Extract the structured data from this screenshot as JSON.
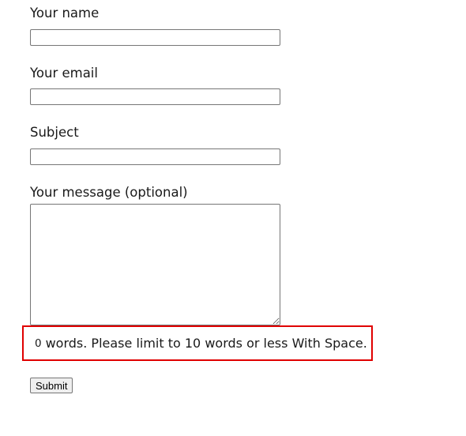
{
  "form": {
    "name": {
      "label": "Your name",
      "value": ""
    },
    "email": {
      "label": "Your email",
      "value": ""
    },
    "subject": {
      "label": "Subject",
      "value": ""
    },
    "message": {
      "label": "Your message (optional)",
      "value": ""
    },
    "word_limit": {
      "count": "0",
      "text": "words. Please limit to 10 words or less With Space.",
      "highlight_color": "#e00000"
    },
    "submit_label": "Submit"
  }
}
